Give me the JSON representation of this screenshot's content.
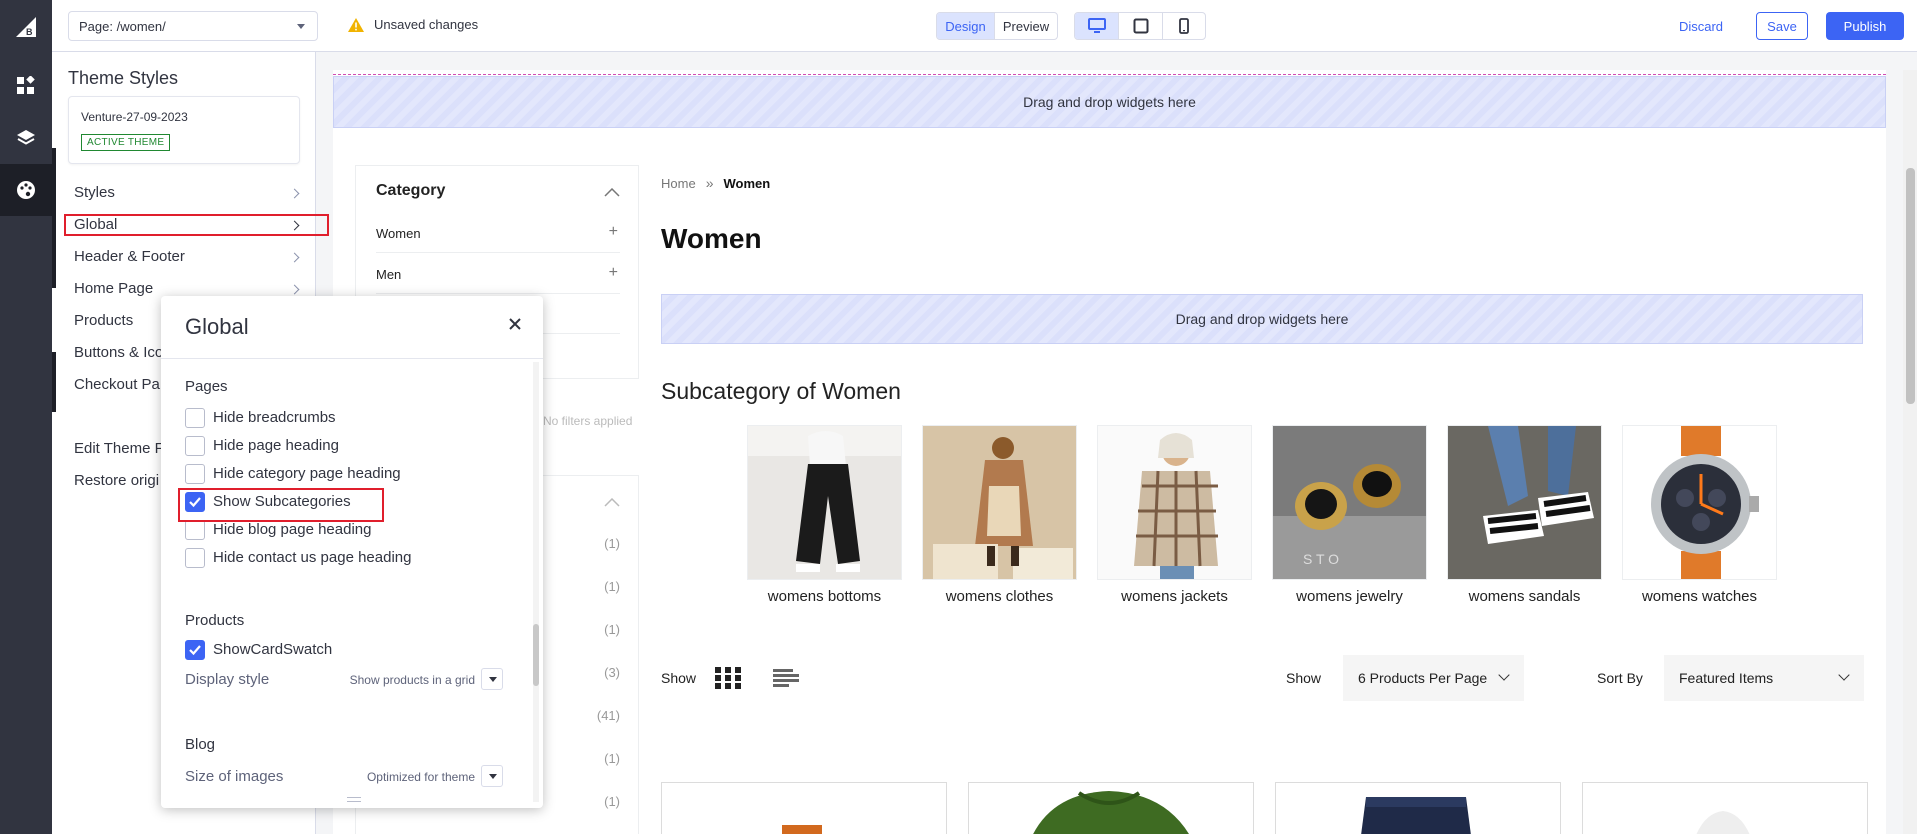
{
  "topbar": {
    "page_select": "Page: /women/",
    "unsaved": "Unsaved changes",
    "mode_design": "Design",
    "mode_preview": "Preview",
    "discard": "Discard",
    "save": "Save",
    "publish": "Publish"
  },
  "sidebar": {
    "title": "Theme Styles",
    "theme_name": "Venture-27-09-2023",
    "active_badge": "ACTIVE THEME",
    "items": [
      "Styles",
      "Global",
      "Header & Footer",
      "Home Page",
      "Products",
      "Buttons & Ico",
      "Checkout Pa"
    ],
    "footer_items": [
      "Edit Theme F",
      "Restore origi"
    ]
  },
  "global_panel": {
    "title": "Global",
    "pages_section": "Pages",
    "pages_options": [
      {
        "label": "Hide breadcrumbs",
        "checked": false
      },
      {
        "label": "Hide page heading",
        "checked": false
      },
      {
        "label": "Hide category page heading",
        "checked": false
      },
      {
        "label": "Show Subcategories",
        "checked": true
      },
      {
        "label": "Hide blog page heading",
        "checked": false
      },
      {
        "label": "Hide contact us page heading",
        "checked": false
      }
    ],
    "products_section": "Products",
    "show_card_swatch": {
      "label": "ShowCardSwatch",
      "checked": true
    },
    "display_style_label": "Display style",
    "display_style_value": "Show products in a grid",
    "blog_section": "Blog",
    "image_size_label": "Size of images",
    "image_size_value": "Optimized for theme"
  },
  "canvas": {
    "dropzone_text": "Drag and drop widgets here",
    "category_title": "Category",
    "categories": [
      {
        "label": "Women"
      },
      {
        "label": "Men"
      }
    ],
    "no_filters": "No filters applied",
    "filter_counts": [
      "(1)",
      "(1)",
      "(1)",
      "(3)",
      "(41)",
      "(1)",
      "(1)"
    ],
    "breadcrumb_home": "Home",
    "breadcrumb_current": "Women",
    "heading": "Women",
    "subcategory_heading": "Subcategory of Women",
    "subcategories": [
      {
        "label": "womens bottoms"
      },
      {
        "label": "womens clothes"
      },
      {
        "label": "womens jackets"
      },
      {
        "label": "womens jewelry"
      },
      {
        "label": "womens sandals"
      },
      {
        "label": "womens watches"
      }
    ],
    "show_label": "Show",
    "per_page_label": "Show",
    "per_page_value": "6 Products Per Page",
    "sort_label": "Sort By",
    "sort_value": "Featured Items"
  },
  "colors": {
    "accent": "#3c64f4",
    "highlight": "#e01e2c",
    "rail": "#313440"
  }
}
